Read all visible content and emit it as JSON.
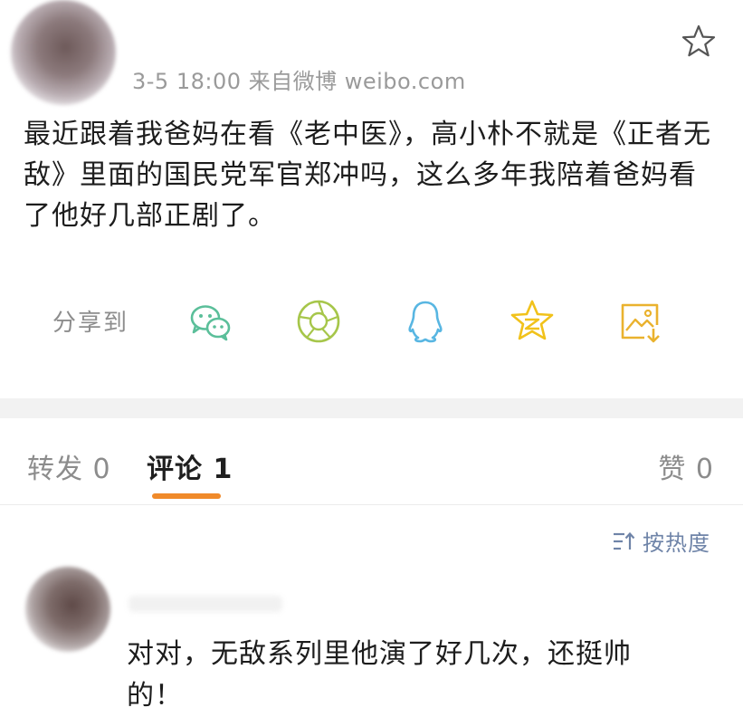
{
  "post": {
    "meta": "3-5 18:00  来自微博 weibo.com",
    "text": "最近跟着我爸妈在看《老中医》，高小朴不就是《正者无敌》里面的国民党军官郑冲吗，这么多年我陪着爸妈看了他好几部正剧了。"
  },
  "share": {
    "label": "分享到",
    "icons": [
      "wechat-icon",
      "moments-icon",
      "qq-icon",
      "qzone-icon",
      "save-image-icon"
    ],
    "colors": {
      "wechat": "#5bbf9a",
      "moments": "#a6c64a",
      "qq": "#58b6e2",
      "qzone": "#f1c21b",
      "save": "#eab22e"
    }
  },
  "tabs": {
    "repost": "转发 0",
    "comment": "评论 1",
    "like": "赞 0",
    "accent": "#f08a2a"
  },
  "sort": {
    "label": "按热度",
    "icon": "sort-icon",
    "color": "#6f84a8"
  },
  "comment": {
    "text": "对对，无敌系列里他演了好几次，还挺帅的！"
  }
}
